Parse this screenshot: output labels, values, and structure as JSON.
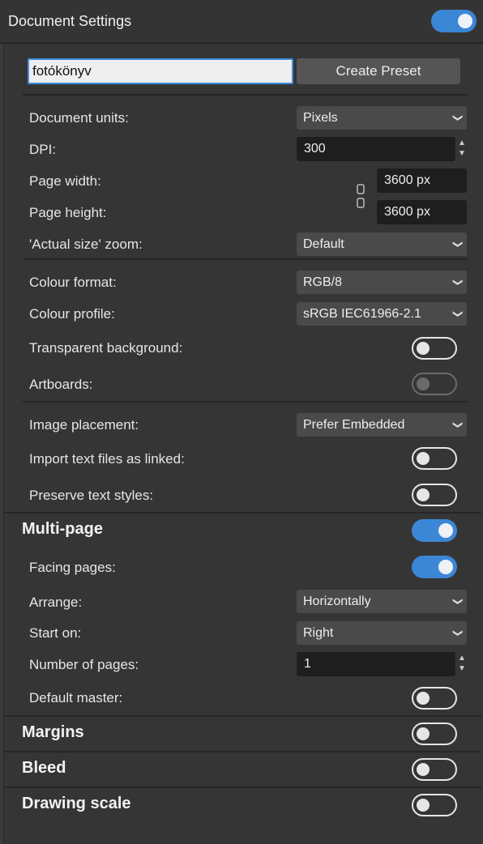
{
  "header": {
    "title": "Document Settings",
    "toggle_on": true
  },
  "preset": {
    "name_value": "fotókönyv",
    "create_label": "Create Preset"
  },
  "rows": {
    "document_units": {
      "label": "Document units:",
      "value": "Pixels"
    },
    "dpi": {
      "label": "DPI:",
      "value": "300"
    },
    "page_width": {
      "label": "Page width:",
      "value": "3600 px"
    },
    "page_height": {
      "label": "Page height:",
      "value": "3600 px"
    },
    "actual_size_zoom": {
      "label": "'Actual size' zoom:",
      "value": "Default"
    },
    "colour_format": {
      "label": "Colour format:",
      "value": "RGB/8"
    },
    "colour_profile": {
      "label": "Colour profile:",
      "value": "sRGB IEC61966-2.1"
    },
    "transparent_background": {
      "label": "Transparent background:",
      "on": false
    },
    "artboards": {
      "label": "Artboards:",
      "on": false,
      "disabled": true
    },
    "image_placement": {
      "label": "Image placement:",
      "value": "Prefer Embedded"
    },
    "import_text_linked": {
      "label": "Import text files as linked:",
      "on": false
    },
    "preserve_text_styles": {
      "label": "Preserve text styles:",
      "on": false
    }
  },
  "multipage": {
    "title": "Multi-page",
    "on": true,
    "facing_pages": {
      "label": "Facing pages:",
      "on": true
    },
    "arrange": {
      "label": "Arrange:",
      "value": "Horizontally"
    },
    "start_on": {
      "label": "Start on:",
      "value": "Right"
    },
    "number_of_pages": {
      "label": "Number of pages:",
      "value": "1"
    },
    "default_master": {
      "label": "Default master:",
      "on": false
    }
  },
  "margins": {
    "title": "Margins",
    "on": false
  },
  "bleed": {
    "title": "Bleed",
    "on": false
  },
  "drawing_scale": {
    "title": "Drawing scale",
    "on": false
  },
  "colors": {
    "accent": "#3c86d6",
    "panel": "#353535",
    "field": "#1e1e1e",
    "dropdown": "#4a4a4a"
  },
  "icons": {
    "dropdown": "chevron-down-icon",
    "spinner": "stepper-arrows-icon",
    "link": "chain-link-icon"
  }
}
